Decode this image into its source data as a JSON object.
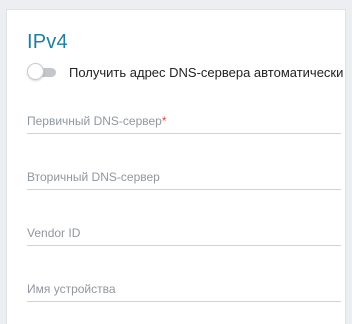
{
  "section": {
    "title": "IPv4"
  },
  "dns_auto": {
    "label": "Получить адрес DNS-сервера автоматически",
    "enabled": false
  },
  "fields": {
    "primary_dns": {
      "placeholder": "Первичный DNS-сервер",
      "required_mark": "*",
      "value": ""
    },
    "secondary_dns": {
      "placeholder": "Вторичный DNS-сервер",
      "value": ""
    },
    "vendor_id": {
      "placeholder": "Vendor ID",
      "value": ""
    },
    "device_name": {
      "placeholder": "Имя устройства",
      "value": ""
    }
  },
  "colors": {
    "title": "#1f7fa3",
    "required": "#e6453a",
    "toggle_off": "#c3c7cc"
  }
}
